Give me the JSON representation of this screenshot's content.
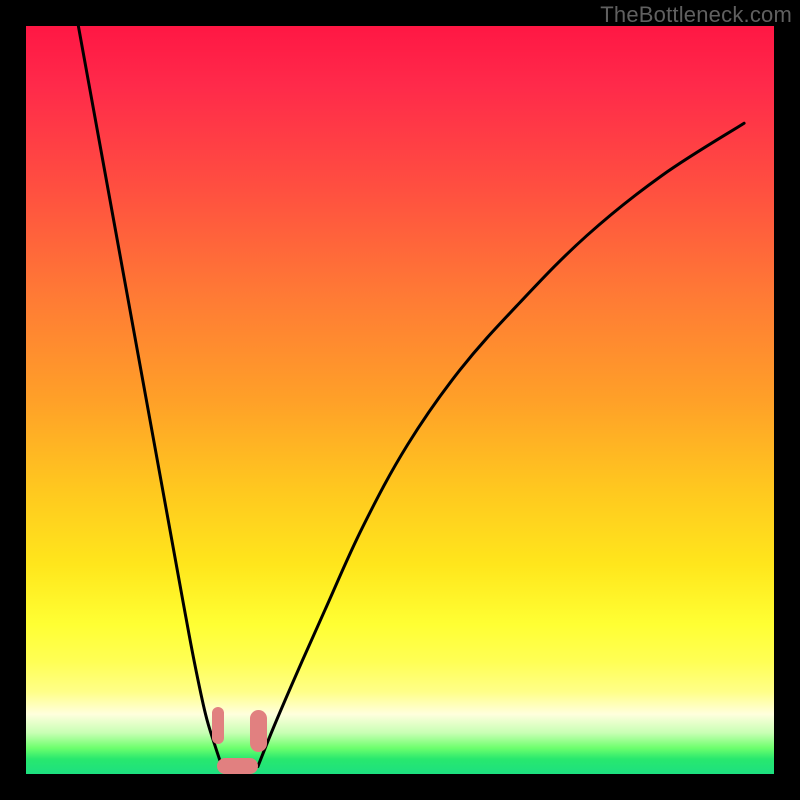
{
  "watermark": "TheBottleneck.com",
  "chart_data": {
    "type": "line",
    "title": "",
    "xlabel": "",
    "ylabel": "",
    "xlim": [
      0,
      100
    ],
    "ylim": [
      0,
      100
    ],
    "grid": false,
    "legend": false,
    "series": [
      {
        "name": "left-branch",
        "x": [
          7,
          9,
          11,
          13,
          15,
          17,
          19,
          21,
          22.5,
          24,
          25.2,
          26.2
        ],
        "values": [
          100,
          89,
          78,
          67,
          56,
          45,
          34,
          23,
          15,
          8,
          4,
          1
        ]
      },
      {
        "name": "right-branch",
        "x": [
          31,
          33,
          36,
          40,
          45,
          51,
          58,
          66,
          75,
          85,
          96
        ],
        "values": [
          1,
          6,
          13,
          22,
          33,
          44,
          54,
          63,
          72,
          80,
          87
        ]
      }
    ],
    "annotations": [
      {
        "name": "marker-left",
        "x_range": [
          24.8,
          26.5
        ],
        "y_range": [
          4.0,
          9.0
        ]
      },
      {
        "name": "marker-floor",
        "x_range": [
          25.5,
          31.0
        ],
        "y_range": [
          0.0,
          2.2
        ]
      },
      {
        "name": "marker-right",
        "x_range": [
          30.0,
          32.2
        ],
        "y_range": [
          3.0,
          8.5
        ]
      }
    ]
  }
}
